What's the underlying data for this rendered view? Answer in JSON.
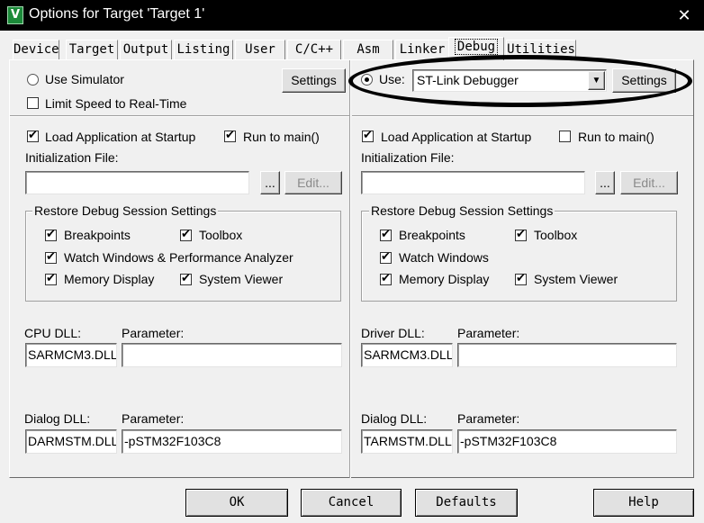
{
  "window": {
    "title": "Options for Target 'Target 1'",
    "close_glyph": "✕",
    "icon_glyph": "V"
  },
  "tabs": [
    "Device",
    "Target",
    "Output",
    "Listing",
    "User",
    "C/C++",
    "Asm",
    "Linker",
    "Debug",
    "Utilities"
  ],
  "active_tab": "Debug",
  "left": {
    "use_simulator": "Use Simulator",
    "limit_speed": "Limit Speed to Real-Time",
    "settings": "Settings",
    "load_app": "Load Application at Startup",
    "run_to_main": "Run to main()",
    "init_file_label": "Initialization File:",
    "init_file_value": "",
    "browse": "...",
    "edit": "Edit...",
    "restore_group": "Restore Debug Session Settings",
    "breakpoints": "Breakpoints",
    "toolbox": "Toolbox",
    "watch_windows": "Watch Windows & Performance Analyzer",
    "memory_display": "Memory Display",
    "system_viewer": "System Viewer",
    "cpu_dll_label": "CPU DLL:",
    "cpu_dll_value": "SARMCM3.DLL",
    "cpu_param_label": "Parameter:",
    "cpu_param_value": "",
    "dialog_dll_label": "Dialog DLL:",
    "dialog_dll_value": "DARMSTM.DLL",
    "dialog_param_label": "Parameter:",
    "dialog_param_value": "-pSTM32F103C8"
  },
  "right": {
    "use": "Use:",
    "debugger": "ST-Link Debugger",
    "settings": "Settings",
    "load_app": "Load Application at Startup",
    "run_to_main": "Run to main()",
    "init_file_label": "Initialization File:",
    "init_file_value": "",
    "browse": "...",
    "edit": "Edit...",
    "restore_group": "Restore Debug Session Settings",
    "breakpoints": "Breakpoints",
    "toolbox": "Toolbox",
    "watch_windows": "Watch Windows",
    "memory_display": "Memory Display",
    "system_viewer": "System Viewer",
    "driver_dll_label": "Driver DLL:",
    "driver_dll_value": "SARMCM3.DLL",
    "driver_param_label": "Parameter:",
    "driver_param_value": "",
    "dialog_dll_label": "Dialog DLL:",
    "dialog_dll_value": "TARMSTM.DLL",
    "dialog_param_label": "Parameter:",
    "dialog_param_value": "-pSTM32F103C8"
  },
  "buttons": {
    "ok": "OK",
    "cancel": "Cancel",
    "defaults": "Defaults",
    "help": "Help"
  },
  "glyphs": {
    "check": "✔",
    "dropdown": "▼"
  }
}
